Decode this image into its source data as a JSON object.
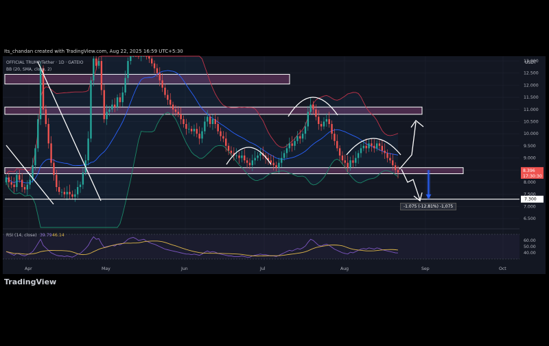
{
  "header": {
    "caption": "Its_chandan created with TradingView.com, Aug 22, 2025 16:59 UTC+5:30",
    "symbol_legend": "OFFICIAL TRUMP/Tether · 1D · GATEIO",
    "bb_legend": "BB (20, SMA, close, 2)",
    "quote_currency": "USDT"
  },
  "footer": {
    "brand": "TradingView"
  },
  "chart_data": [
    {
      "type": "candlestick",
      "title": "OFFICIAL TRUMP/Tether · 1D · GATEIO",
      "ylabel": "USDT",
      "ylim": [
        6.0,
        13.1
      ],
      "y_ticks": [
        "13.000",
        "12.500",
        "12.000",
        "11.500",
        "11.000",
        "10.500",
        "10.000",
        "9.500",
        "9.000",
        "8.500",
        "8.000",
        "7.500",
        "7.000",
        "6.500"
      ],
      "x_ticks": [
        "Apr",
        "May",
        "Jun",
        "Jul",
        "Aug",
        "Sep",
        "Oct"
      ],
      "current_price": "8.396",
      "countdown": "17:30:30",
      "target_price": "7.300",
      "measurement_label": "-1.075 (-12.81%) -1,075",
      "zones": [
        {
          "label": "resistance-top",
          "low": 12.05,
          "high": 12.45
        },
        {
          "label": "resistance-mid",
          "low": 10.8,
          "high": 11.1
        },
        {
          "label": "support",
          "low": 8.35,
          "high": 8.6
        }
      ],
      "close_series": [
        8.2,
        8.0,
        7.9,
        7.8,
        8.3,
        8.1,
        7.8,
        7.7,
        7.9,
        8.1,
        8.7,
        9.4,
        10.6,
        12.7,
        11.0,
        10.4,
        9.6,
        8.8,
        8.3,
        7.8,
        7.6,
        7.6,
        7.5,
        7.6,
        7.5,
        7.4,
        7.5,
        7.8,
        7.9,
        8.4,
        8.9,
        9.8,
        12.2,
        13.1,
        12.8,
        13.0,
        11.8,
        10.6,
        10.9,
        11.0,
        11.2,
        11.1,
        11.5,
        11.3,
        11.7,
        12.3,
        13.0,
        13.4,
        13.6,
        13.5,
        13.2,
        13.4,
        13.6,
        13.3,
        13.1,
        12.9,
        12.7,
        12.5,
        12.2,
        11.9,
        11.6,
        11.4,
        11.2,
        11.0,
        10.9,
        10.8,
        10.6,
        10.4,
        10.2,
        10.2,
        10.1,
        10.2,
        10.0,
        9.8,
        10.1,
        10.5,
        10.7,
        10.4,
        10.6,
        10.4,
        10.1,
        9.9,
        9.8,
        9.5,
        9.3,
        9.2,
        9.1,
        9.1,
        9.0,
        9.1,
        8.9,
        8.8,
        8.7,
        8.9,
        9.0,
        9.1,
        9.2,
        9.1,
        9.0,
        8.9,
        8.8,
        8.7,
        8.6,
        8.8,
        9.0,
        9.2,
        9.4,
        9.6,
        9.5,
        9.7,
        9.9,
        9.8,
        10.0,
        10.3,
        10.9,
        11.2,
        11.0,
        10.7,
        10.4,
        10.3,
        10.5,
        10.6,
        10.4,
        10.0,
        9.7,
        9.4,
        9.1,
        8.9,
        8.8,
        8.6,
        8.9,
        8.8,
        9.0,
        9.2,
        9.4,
        9.5,
        9.4,
        9.6,
        9.5,
        9.4,
        9.6,
        9.5,
        9.3,
        9.2,
        9.0,
        8.9,
        8.7,
        8.5,
        8.4
      ],
      "rsi": {
        "label": "RSI (14, close)",
        "value": "39.79",
        "ma_value": "46.14",
        "y_ticks": [
          "60.00",
          "50.00",
          "40.00"
        ],
        "ylim": [
          30,
          72
        ],
        "values": [
          42,
          40,
          38,
          36,
          39,
          38,
          36,
          35,
          37,
          39,
          42,
          48,
          55,
          62,
          52,
          48,
          44,
          40,
          38,
          36,
          35,
          35,
          34,
          35,
          34,
          33,
          35,
          38,
          39,
          43,
          47,
          52,
          60,
          66,
          62,
          63,
          55,
          49,
          50,
          51,
          52,
          51,
          54,
          53,
          55,
          58,
          62,
          64,
          65,
          63,
          60,
          61,
          62,
          59,
          57,
          55,
          54,
          52,
          50,
          48,
          46,
          45,
          44,
          43,
          42,
          41,
          40,
          39,
          38,
          38,
          37,
          38,
          37,
          36,
          38,
          41,
          43,
          41,
          42,
          41,
          39,
          38,
          37,
          36,
          35,
          35,
          34,
          34,
          34,
          35,
          34,
          33,
          33,
          35,
          36,
          37,
          38,
          37,
          37,
          36,
          35,
          35,
          34,
          36,
          38,
          40,
          42,
          44,
          43,
          45,
          47,
          46,
          48,
          51,
          57,
          62,
          60,
          56,
          52,
          51,
          53,
          54,
          52,
          49,
          46,
          44,
          42,
          40,
          39,
          38,
          41,
          40,
          42,
          44,
          46,
          47,
          46,
          48,
          47,
          46,
          48,
          47,
          45,
          44,
          43,
          42,
          41,
          40,
          39.8
        ]
      }
    }
  ],
  "annotation_price": "7.300"
}
